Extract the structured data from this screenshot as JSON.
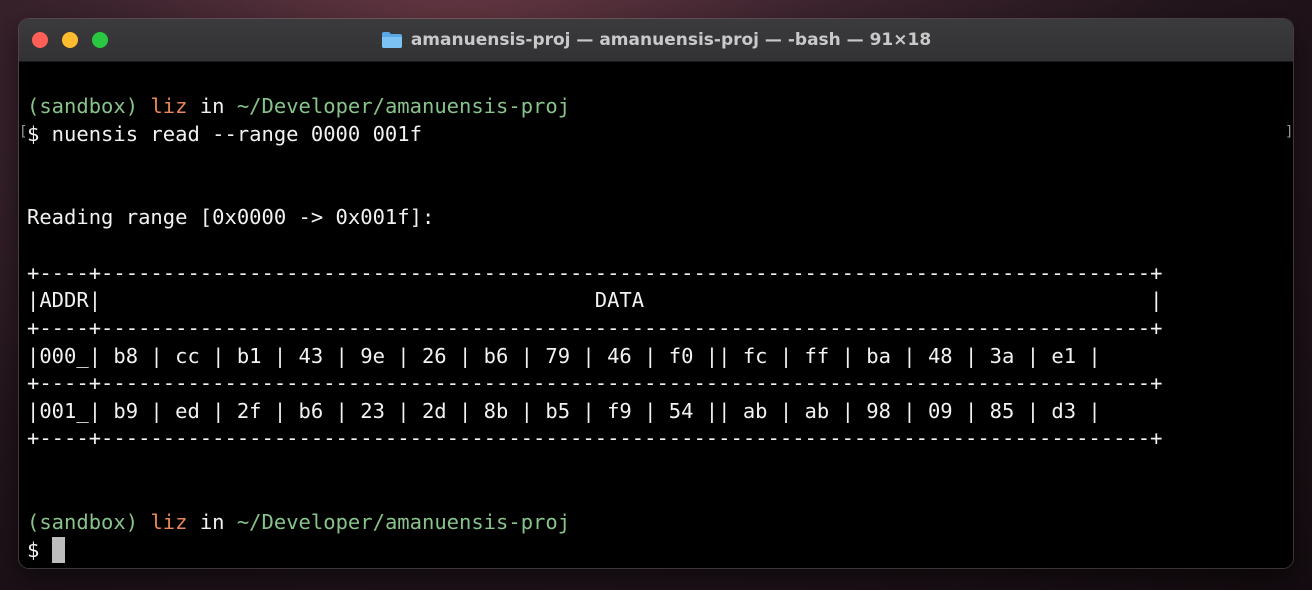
{
  "window": {
    "title": "amanuensis-proj — amanuensis-proj — -bash — 91×18",
    "folder_icon": "folder-icon",
    "colors": {
      "close": "#ff5f57",
      "minimize": "#febc2e",
      "zoom": "#28c840"
    }
  },
  "terminal": {
    "prompt1": {
      "env": "(sandbox)",
      "user": "liz",
      "in": "in",
      "path": "~/Developer/amanuensis-proj"
    },
    "command": "$ nuensis read --range 0000 001f",
    "reading": "Reading range [0x0000 -> 0x001f]:",
    "table": {
      "border": "+----+-------------------------------------------------------------------------------------+",
      "header": "|ADDR|                                        DATA                                         |",
      "rows": [
        "|000_| b8 | cc | b1 | 43 | 9e | 26 | b6 | 79 | 46 | f0 || fc | ff | ba | 48 | 3a | e1 |",
        "|001_| b9 | ed | 2f | b6 | 23 | 2d | 8b | b5 | f9 | 54 || ab | ab | 98 | 09 | 85 | d3 |"
      ]
    },
    "prompt2": {
      "env": "(sandbox)",
      "user": "liz",
      "in": "in",
      "path": "~/Developer/amanuensis-proj"
    },
    "prompt_symbol": "$ ",
    "brackets": {
      "left": "[",
      "right": "]"
    },
    "colors": {
      "green": "#87c38a",
      "orange": "#e8875a",
      "text": "#f2f2f2",
      "background": "#000000"
    }
  }
}
